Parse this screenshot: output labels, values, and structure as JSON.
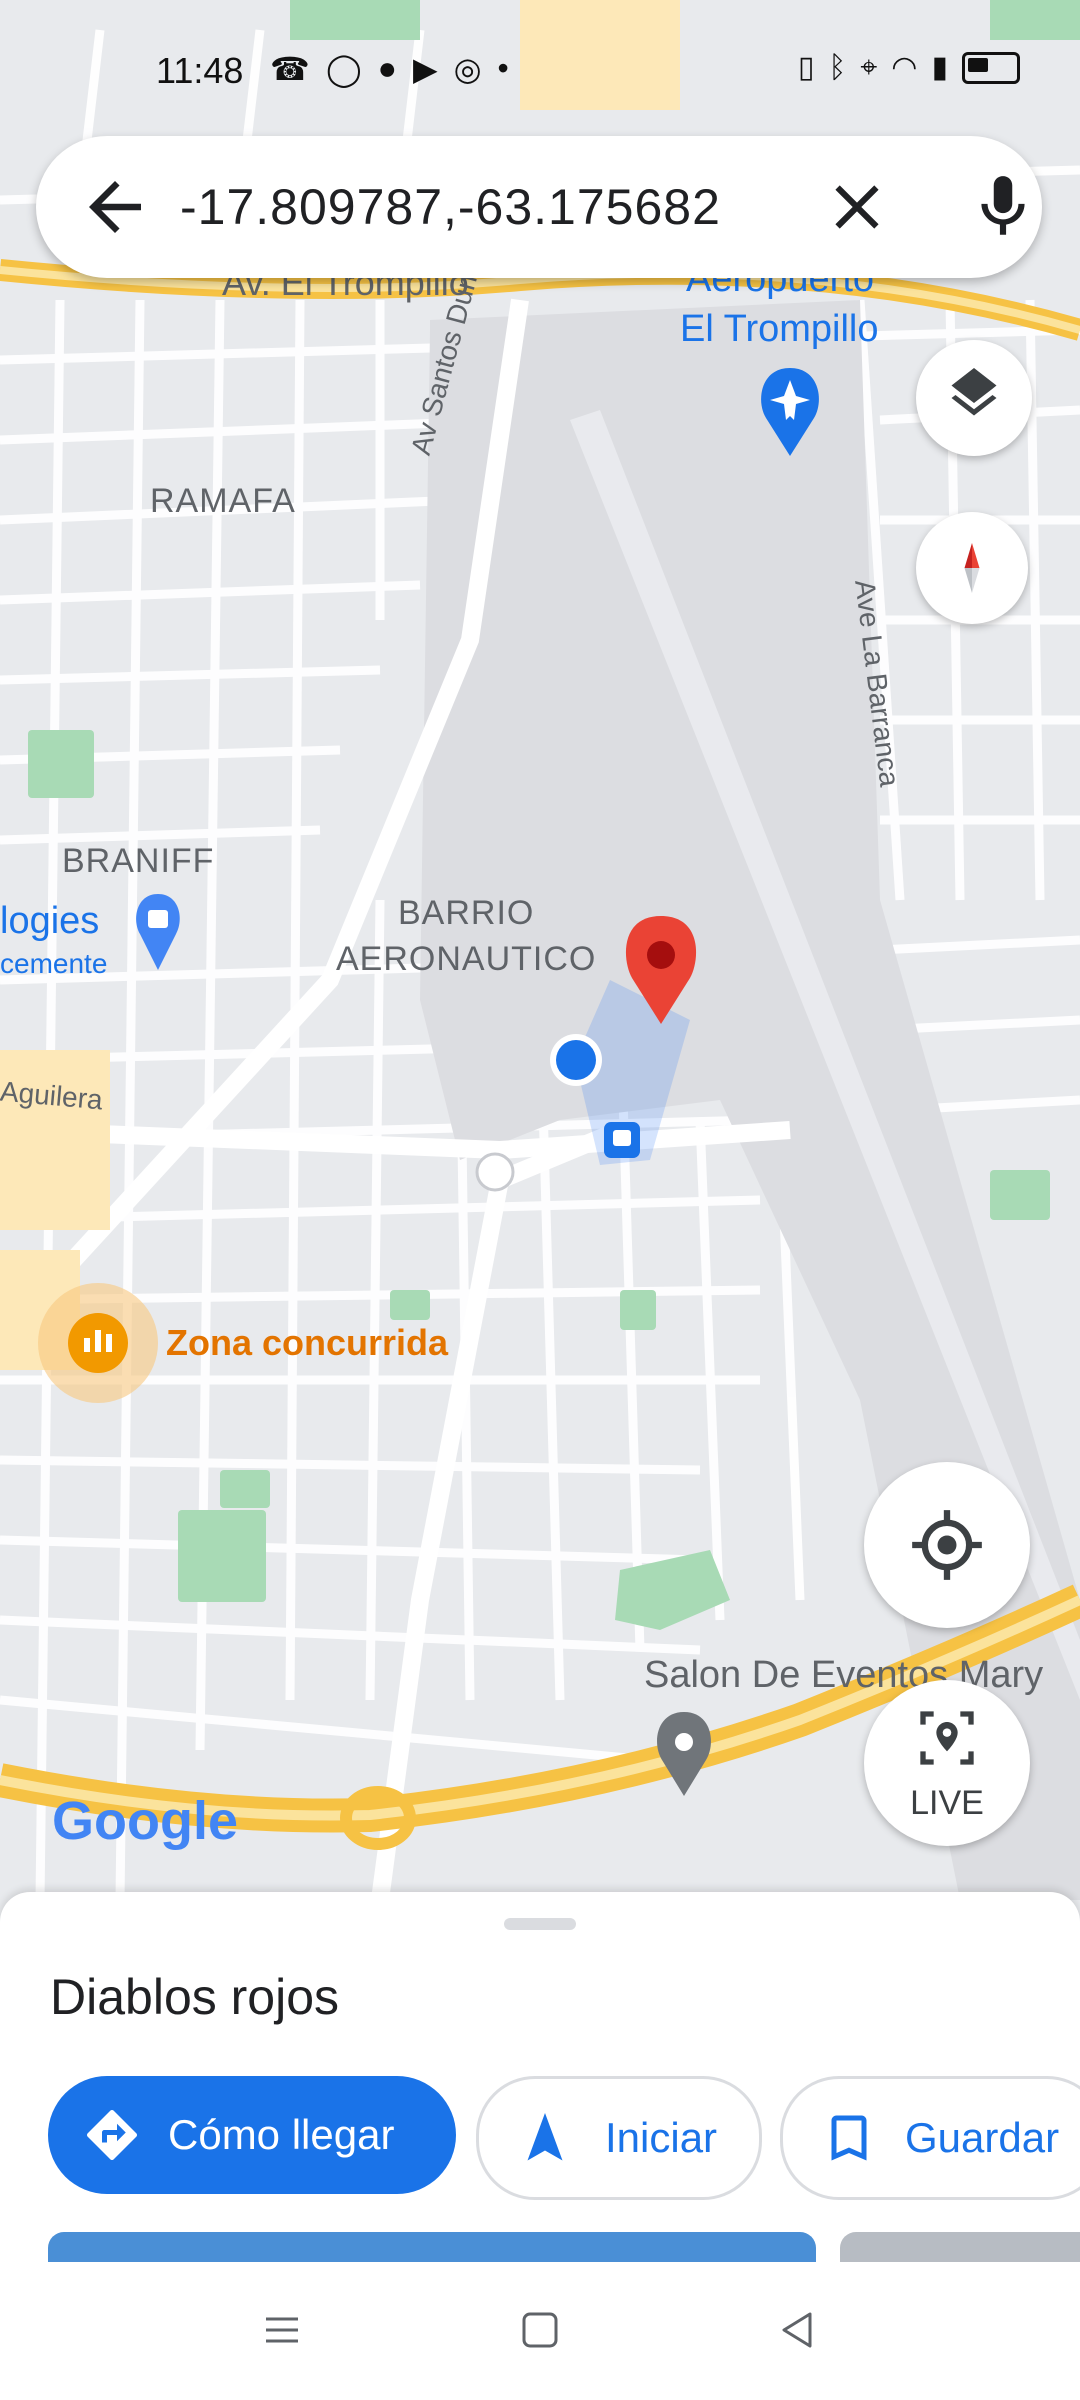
{
  "status_bar": {
    "time": "11:48",
    "left_icons": [
      "missed-call-icon",
      "whatsapp-icon",
      "facebook-icon",
      "youtube-icon",
      "chrome-icon",
      "dot-icon"
    ],
    "right_icons": [
      "vibrate-icon",
      "bluetooth-icon",
      "location-icon",
      "wifi-icon",
      "signal-icon",
      "battery-icon"
    ]
  },
  "search": {
    "query": "-17.809787,-63.175682"
  },
  "map": {
    "labels": {
      "road_trompillo": "Av. El Trompillo",
      "airport_line1": "Aeropuerto",
      "airport_line2": "El Trompillo",
      "ramafa": "RAMAFA",
      "santos_dumont": "Av Santos Dumont",
      "la_barranca": "Ave La Barranca",
      "braniff": "BRANIFF",
      "barrio_line1": "BARRIO",
      "barrio_line2": "AERONAUTICO",
      "logies": "logies",
      "cemente": "cemente",
      "aguilera": "Aguilera",
      "busy_zone": "Zona concurrida",
      "salon": "Salon De Eventos Mary",
      "google_logo": "Google"
    },
    "live_label": "LIVE"
  },
  "colors": {
    "accent_blue": "#1a73e8",
    "pin_red": "#ea4335",
    "road_yellow": "#f6c244",
    "busy_orange": "#e37400"
  },
  "sheet": {
    "place_name": "Diablos rojos",
    "actions": {
      "directions": "Cómo llegar",
      "start": "Iniciar",
      "save": "Guardar"
    }
  }
}
